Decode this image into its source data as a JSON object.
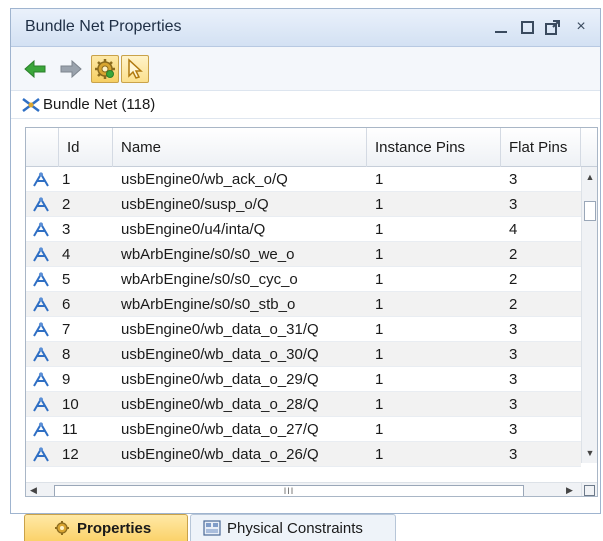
{
  "window": {
    "title": "Bundle Net Properties",
    "controls": {
      "minimize": "minimize",
      "maximize": "maximize",
      "float": "float",
      "close": "×"
    }
  },
  "toolbar": {
    "buttons": [
      {
        "name": "back",
        "icon": "arrow-left-icon"
      },
      {
        "name": "forward",
        "icon": "arrow-right-icon"
      },
      {
        "name": "properties-settings",
        "icon": "gear-icon"
      },
      {
        "name": "select",
        "icon": "pointer-icon"
      }
    ]
  },
  "object": {
    "label": "Bundle Net (118)",
    "icon": "bundle-net-icon"
  },
  "table": {
    "columns": [
      "",
      "Id",
      "Name",
      "Instance Pins",
      "Flat Pins"
    ],
    "rows": [
      {
        "id": "1",
        "name": "usbEngine0/wb_ack_o/Q",
        "instance_pins": "1",
        "flat_pins": "3"
      },
      {
        "id": "2",
        "name": "usbEngine0/susp_o/Q",
        "instance_pins": "1",
        "flat_pins": "3"
      },
      {
        "id": "3",
        "name": "usbEngine0/u4/inta/Q",
        "instance_pins": "1",
        "flat_pins": "4"
      },
      {
        "id": "4",
        "name": "wbArbEngine/s0/s0_we_o",
        "instance_pins": "1",
        "flat_pins": "2"
      },
      {
        "id": "5",
        "name": "wbArbEngine/s0/s0_cyc_o",
        "instance_pins": "1",
        "flat_pins": "2"
      },
      {
        "id": "6",
        "name": "wbArbEngine/s0/s0_stb_o",
        "instance_pins": "1",
        "flat_pins": "2"
      },
      {
        "id": "7",
        "name": "usbEngine0/wb_data_o_31/Q",
        "instance_pins": "1",
        "flat_pins": "3"
      },
      {
        "id": "8",
        "name": "usbEngine0/wb_data_o_30/Q",
        "instance_pins": "1",
        "flat_pins": "3"
      },
      {
        "id": "9",
        "name": "usbEngine0/wb_data_o_29/Q",
        "instance_pins": "1",
        "flat_pins": "3"
      },
      {
        "id": "10",
        "name": "usbEngine0/wb_data_o_28/Q",
        "instance_pins": "1",
        "flat_pins": "3"
      },
      {
        "id": "11",
        "name": "usbEngine0/wb_data_o_27/Q",
        "instance_pins": "1",
        "flat_pins": "3"
      },
      {
        "id": "12",
        "name": "usbEngine0/wb_data_o_26/Q",
        "instance_pins": "1",
        "flat_pins": "3"
      }
    ],
    "row_icon": "net-icon",
    "hscroll_grip": "III"
  },
  "tabs": [
    {
      "label": "Properties",
      "icon": "gear-icon",
      "active": true
    },
    {
      "label": "Physical Constraints",
      "icon": "constraints-icon",
      "active": false
    }
  ],
  "colors": {
    "accent": "#fbd26a",
    "title_bg": "#d3e1f3",
    "row_alt": "#f2f2f2",
    "icon_blue": "#2f6fc4",
    "arrow_green": "#3aa63a"
  }
}
